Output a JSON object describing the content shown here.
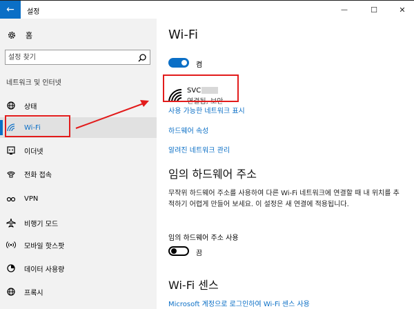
{
  "window": {
    "title": "설정",
    "back_glyph": "←",
    "minimize_glyph": "—",
    "maximize_glyph": "☐",
    "close_glyph": "✕"
  },
  "sidebar": {
    "home_label": "홈",
    "search_placeholder": "설정 찾기",
    "section_title": "네트워크 및 인터넷",
    "items": [
      {
        "label": "상태",
        "icon": "globe-icon"
      },
      {
        "label": "Wi-Fi",
        "icon": "wifi-icon",
        "selected": true
      },
      {
        "label": "이더넷",
        "icon": "ethernet-icon"
      },
      {
        "label": "전화 접속",
        "icon": "dial-up-icon"
      },
      {
        "label": "VPN",
        "icon": "vpn-icon"
      },
      {
        "label": "비행기 모드",
        "icon": "airplane-icon"
      },
      {
        "label": "모바일 핫스팟",
        "icon": "hotspot-icon"
      },
      {
        "label": "데이터 사용량",
        "icon": "data-usage-icon"
      },
      {
        "label": "프록시",
        "icon": "proxy-icon"
      }
    ]
  },
  "main": {
    "title": "Wi-Fi",
    "wifi_toggle": {
      "state": "on",
      "label": "켬"
    },
    "network": {
      "ssid": "SVC",
      "status": "연결됨, 보안",
      "icon": "wifi-signal-icon"
    },
    "links": {
      "available": "사용 가능한 네트워크 표시",
      "hardware": "하드웨어 속성",
      "known": "알려진 네트워크 관리"
    },
    "random_hw": {
      "heading": "임의 하드웨어 주소",
      "description": "무작위 하드웨어 주소를 사용하여 다른 Wi-Fi 네트워크에 연결할 때 내 위치를 추적하기 어렵게 만들어 보세요. 이 설정은 새 연결에 적용됩니다.",
      "toggle_label": "임의 하드웨어 주소 사용",
      "toggle": {
        "state": "off",
        "label": "끔"
      }
    },
    "sense": {
      "heading": "Wi-Fi 센스",
      "link": "Microsoft 계정으로 로그인하여 Wi-Fi 센스 사용"
    }
  },
  "colors": {
    "accent": "#0b6fc6",
    "annotation": "#e21b1b",
    "sidebar_bg": "#f2f2f2",
    "selected_bg": "#e1e1e1"
  }
}
